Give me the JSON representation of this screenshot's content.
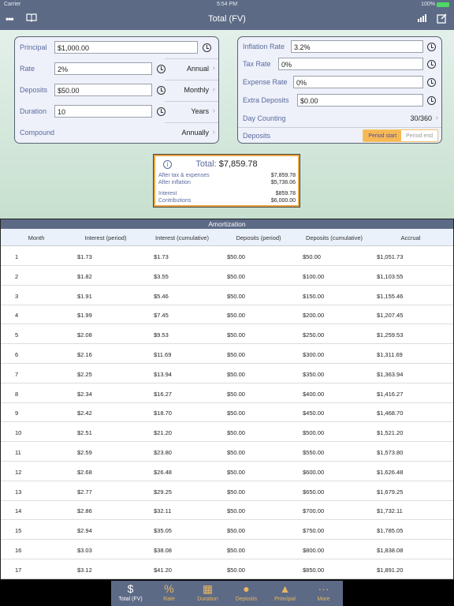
{
  "status": {
    "carrier": "Carrier",
    "time": "5:54 PM",
    "battery": "100%"
  },
  "nav": {
    "title": "Total (FV)",
    "left_icons": [
      "more-icon",
      "book-icon"
    ],
    "right_icons": [
      "chart-icon",
      "edit-icon"
    ]
  },
  "left_panel": {
    "principal": {
      "label": "Principal",
      "value": "$1,000.00"
    },
    "rate": {
      "label": "Rate",
      "value": "2%",
      "unit": "Annual"
    },
    "deposits": {
      "label": "Deposits",
      "value": "$50.00",
      "unit": "Monthly"
    },
    "duration": {
      "label": "Duration",
      "value": "10",
      "unit": "Years"
    },
    "compound": {
      "label": "Compound",
      "value": "Annually"
    }
  },
  "right_panel": {
    "inflation": {
      "label": "Inflation Rate",
      "value": "3.2%"
    },
    "tax": {
      "label": "Tax Rate",
      "value": "0%"
    },
    "expense": {
      "label": "Expense Rate",
      "value": "0%"
    },
    "extra": {
      "label": "Extra Deposits",
      "value": "$0.00"
    },
    "day_counting": {
      "label": "Day Counting",
      "value": "30/360"
    },
    "deposits_timing": {
      "label": "Deposits",
      "options": [
        "Period start",
        "Period end"
      ],
      "selected": "Period start"
    }
  },
  "summary": {
    "total_label": "Total:",
    "total": "$7,859.78",
    "after_tax_label": "After tax & expenses",
    "after_tax": "$7,859.78",
    "after_inflation_label": "After inflation",
    "after_inflation": "$5,736.06",
    "interest_label": "Interest",
    "interest": "$859.78",
    "contributions_label": "Contributions",
    "contributions": "$6,000.00"
  },
  "amortization": {
    "title": "Amortization",
    "columns": [
      "Month",
      "Interest  (period)",
      "Interest  (cumulative)",
      "Deposits (period)",
      "Deposits (cumulative)",
      "Accrual"
    ],
    "rows": [
      [
        "1",
        "$1.73",
        "$1.73",
        "$50.00",
        "$50.00",
        "$1,051.73"
      ],
      [
        "2",
        "$1.82",
        "$3.55",
        "$50.00",
        "$100.00",
        "$1,103.55"
      ],
      [
        "3",
        "$1.91",
        "$5.46",
        "$50.00",
        "$150.00",
        "$1,155.46"
      ],
      [
        "4",
        "$1.99",
        "$7.45",
        "$50.00",
        "$200.00",
        "$1,207.45"
      ],
      [
        "5",
        "$2.08",
        "$9.53",
        "$50.00",
        "$250.00",
        "$1,259.53"
      ],
      [
        "6",
        "$2.16",
        "$11.69",
        "$50.00",
        "$300.00",
        "$1,311.69"
      ],
      [
        "7",
        "$2.25",
        "$13.94",
        "$50.00",
        "$350.00",
        "$1,363.94"
      ],
      [
        "8",
        "$2.34",
        "$16.27",
        "$50.00",
        "$400.00",
        "$1,416.27"
      ],
      [
        "9",
        "$2.42",
        "$18.70",
        "$50.00",
        "$450.00",
        "$1,468.70"
      ],
      [
        "10",
        "$2.51",
        "$21.20",
        "$50.00",
        "$500.00",
        "$1,521.20"
      ],
      [
        "11",
        "$2.59",
        "$23.80",
        "$50.00",
        "$550.00",
        "$1,573.80"
      ],
      [
        "12",
        "$2.68",
        "$26.48",
        "$50.00",
        "$600.00",
        "$1,626.48"
      ],
      [
        "13",
        "$2.77",
        "$29.25",
        "$50.00",
        "$650.00",
        "$1,679.25"
      ],
      [
        "14",
        "$2.86",
        "$32.11",
        "$50.00",
        "$700.00",
        "$1,732.11"
      ],
      [
        "15",
        "$2.94",
        "$35.05",
        "$50.00",
        "$750.00",
        "$1,785.05"
      ],
      [
        "16",
        "$3.03",
        "$38.08",
        "$50.00",
        "$800.00",
        "$1,838.08"
      ],
      [
        "17",
        "$3.12",
        "$41.20",
        "$50.00",
        "$850.00",
        "$1,891.20"
      ]
    ]
  },
  "tabs": [
    {
      "label": "Total (FV)",
      "icon": "money-bag-icon",
      "glyph": "$",
      "selected": true
    },
    {
      "label": "Rate",
      "icon": "percent-icon",
      "glyph": "%"
    },
    {
      "label": "Duration",
      "icon": "calendar-icon",
      "glyph": "▦"
    },
    {
      "label": "Deposits",
      "icon": "piggy-bank-icon",
      "glyph": "●"
    },
    {
      "label": "Principal",
      "icon": "principal-icon",
      "glyph": "▲"
    },
    {
      "label": "More",
      "icon": "more-icon",
      "glyph": "···"
    }
  ],
  "colors": {
    "nav": "#5c6a85",
    "accent": "#f7b955",
    "label": "#5a6a9e"
  }
}
